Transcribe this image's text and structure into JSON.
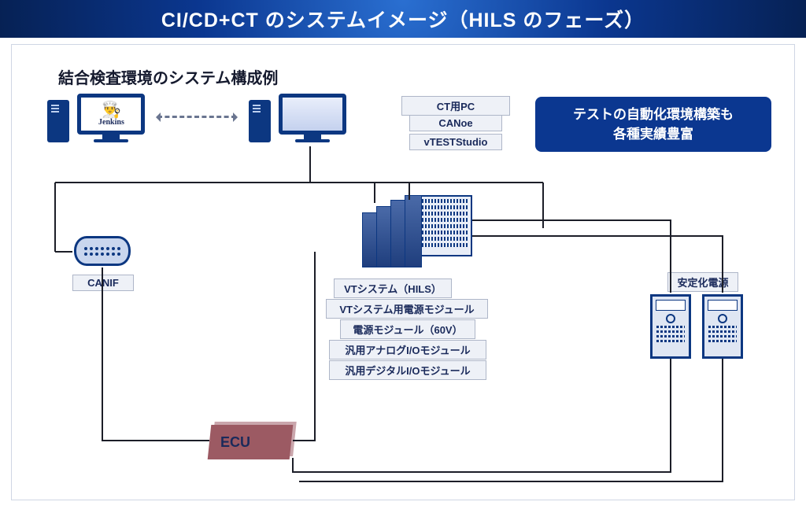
{
  "title": "CI/CD+CT のシステムイメージ（HILS のフェーズ）",
  "subtitle": "結合検査環境のシステム構成例",
  "jenkins": {
    "name": "Jenkins",
    "glyph": "👨‍🍳"
  },
  "pc_labels": {
    "ct_pc": "CT用PC",
    "canoe": "CANoe",
    "vteststudio": "vTESTStudio"
  },
  "callout": {
    "line1": "テストの自動化環境構築も",
    "line2": "各種実績豊富"
  },
  "vt_labels": {
    "system": "VTシステム（HILS）",
    "power_module": "VTシステム用電源モジュール",
    "power_60v": "電源モジュール（60V）",
    "analog_io": "汎用アナログI/Oモジュール",
    "digital_io": "汎用デジタルI/Oモジュール"
  },
  "canif_label": "CANIF",
  "psu_label": "安定化電源",
  "ecu_label": "ECU"
}
